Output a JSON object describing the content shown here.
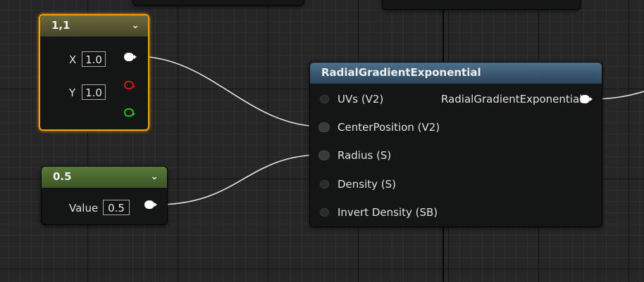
{
  "node_vec2": {
    "title": "1,1",
    "x_label": "X",
    "x_value": "1.0",
    "y_label": "Y",
    "y_value": "1.0"
  },
  "node_scalar": {
    "title": "0.5",
    "value_label": "Value",
    "value": "0.5"
  },
  "node_radial": {
    "title": "RadialGradientExponential",
    "inputs": [
      "UVs (V2)",
      "CenterPosition (V2)",
      "Radius (S)",
      "Density (S)",
      "Invert Density (SB)"
    ],
    "output": "RadialGradientExponential"
  },
  "colors": {
    "selection": "#f5a000",
    "gold_header": "#6d6a3d",
    "green_header": "#5a7a36",
    "blue_header": "#4d6f8a",
    "pin_red": "#e01010",
    "pin_green": "#19c519"
  }
}
